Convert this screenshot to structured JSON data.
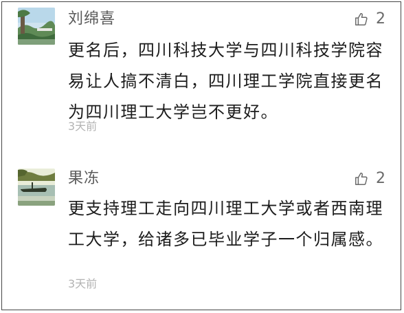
{
  "comments": [
    {
      "author": "刘绵喜",
      "likes": "2",
      "text": "更名后，四川科技大学与四川科技学院容易让人搞不清白，四川理工学院直接更名为四川理工大学岂不更好。",
      "time": "3天前",
      "avatar_icon": "landscape-photo-icon",
      "like_icon": "thumbs-up-icon"
    },
    {
      "author": "果冻",
      "likes": "2",
      "text": "更支持理工走向四川理工大学或者西南理工大学，给诸多已毕业学子一个归属感。",
      "time": "3天前",
      "avatar_icon": "boat-on-lake-photo-icon",
      "like_icon": "thumbs-up-icon"
    }
  ]
}
